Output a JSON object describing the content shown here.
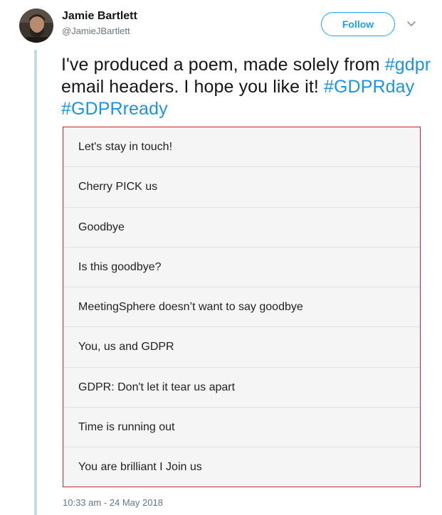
{
  "author": {
    "name": "Jamie Bartlett",
    "handle": "@JamieJBartlett"
  },
  "actions": {
    "follow_label": "Follow",
    "caret_icon": "chevron-down-icon"
  },
  "tweet": {
    "text_part1": "I've produced a poem, made solely from ",
    "tag1": "#gdpr",
    "text_part2": " email headers. I hope you like it! ",
    "tag2": "#GDPRday",
    "tag3": "#GDPRready"
  },
  "poem": {
    "lines": [
      "Let's stay in touch!",
      "Cherry PICK us",
      "Goodbye",
      "Is this goodbye?",
      "MeetingSphere doesn’t want to say goodbye",
      "You, us and GDPR",
      "GDPR: Don't let it tear us apart",
      "Time is running out",
      "You are brilliant I Join us"
    ]
  },
  "timestamp": "10:33 am - 24 May 2018",
  "colors": {
    "accent": "#1da1f2",
    "hashtag": "#1b95e0",
    "card_border": "#c0282a",
    "thread_line": "#c4d9ea"
  }
}
